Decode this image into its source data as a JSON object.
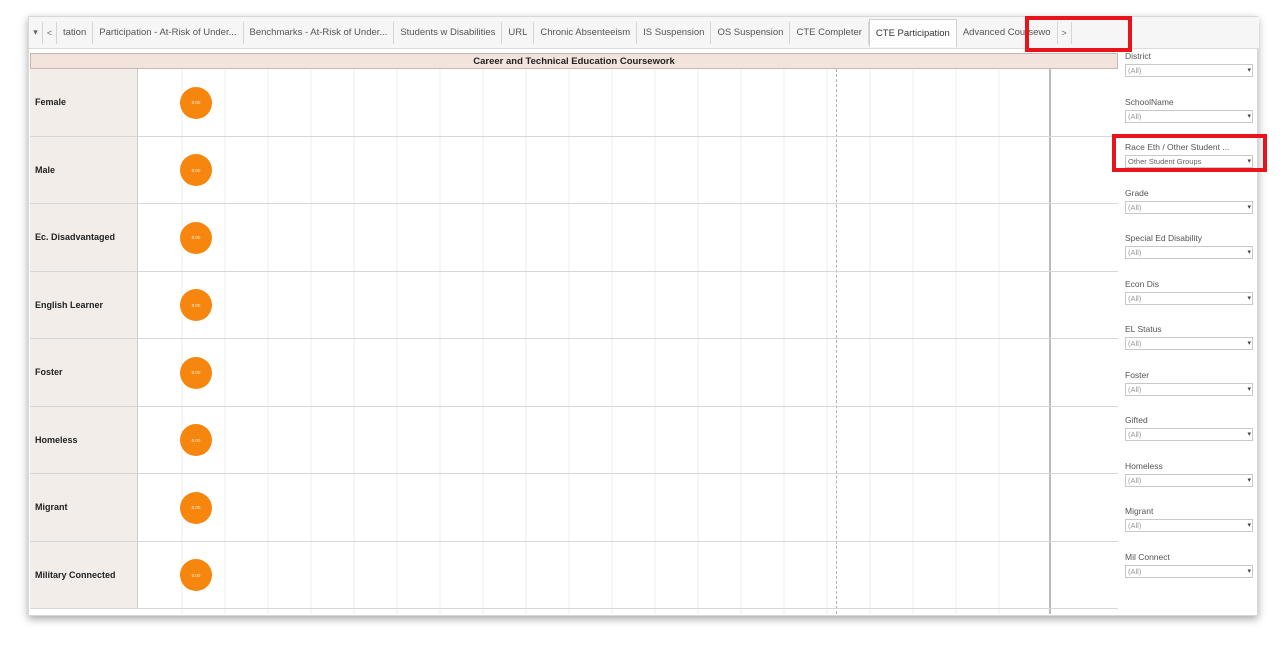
{
  "tabs": {
    "dropdown_glyph": "▾",
    "prev_glyph": "<",
    "next_glyph": ">",
    "items": [
      "tation",
      "Participation - At-Risk of Under...",
      "Benchmarks - At-Risk of Under...",
      "Students w Disabilities",
      "URL",
      "Chronic Absenteeism",
      "IS Suspension",
      "OS Suspension",
      "CTE Completer",
      "CTE Participation",
      "Advanced Coursewo"
    ],
    "active_index": 9
  },
  "chart_data": {
    "type": "scatter",
    "title": "Career and Technical Education Coursework",
    "categories": [
      "Female",
      "Male",
      "Ec. Disadvantaged",
      "English Learner",
      "Foster",
      "Homeless",
      "Migrant",
      "Military Connected"
    ],
    "values": [
      0,
      0,
      0,
      0,
      0,
      0,
      0,
      0
    ],
    "mark_labels": [
      "0.00",
      "0.00",
      "0.00",
      "0.00",
      "0.00",
      "0.00",
      "0.00",
      "0.00"
    ],
    "mark_color": "#f7860f"
  },
  "filters": [
    {
      "label": "District",
      "value": "(All)"
    },
    {
      "label": "SchoolName",
      "value": "(All)"
    },
    {
      "label": "Race Eth / Other Student ...",
      "value": "Other Student Groups"
    },
    {
      "label": "Grade",
      "value": "(All)"
    },
    {
      "label": "Special Ed Disability",
      "value": "(All)"
    },
    {
      "label": "Econ Dis",
      "value": "(All)"
    },
    {
      "label": "EL Status",
      "value": "(All)"
    },
    {
      "label": "Foster",
      "value": "(All)"
    },
    {
      "label": "Gifted",
      "value": "(All)"
    },
    {
      "label": "Homeless",
      "value": "(All)"
    },
    {
      "label": "Migrant",
      "value": "(All)"
    },
    {
      "label": "Mil Connect",
      "value": "(All)"
    }
  ],
  "colors": {
    "highlight": "#e8141b",
    "title_band": "#f3e3dd",
    "row_header": "#f2ede9"
  }
}
